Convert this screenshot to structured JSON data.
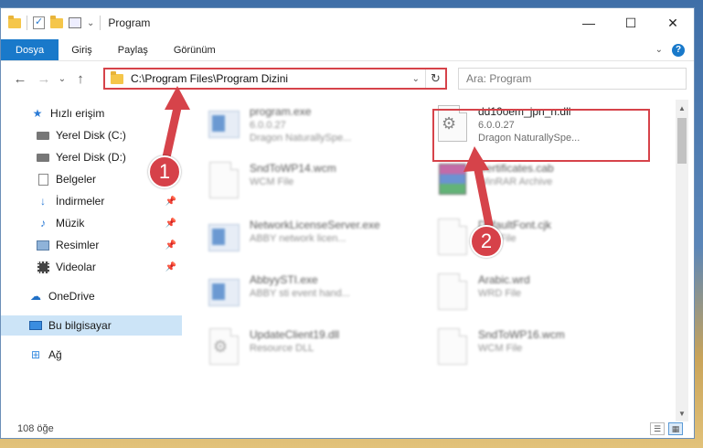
{
  "titlebar": {
    "title": "Program",
    "minimize": "—",
    "maximize": "☐",
    "close": "✕"
  },
  "ribbon": {
    "tabs": [
      {
        "label": "Dosya",
        "active": true
      },
      {
        "label": "Giriş"
      },
      {
        "label": "Paylaş"
      },
      {
        "label": "Görünüm"
      }
    ],
    "expand_glyph": "⌄",
    "help_glyph": "?"
  },
  "navigation": {
    "back": "←",
    "forward": "→",
    "history": "⌄",
    "up": "↑",
    "address_path": "C:\\Program Files\\Program Dizini",
    "address_dropdown": "⌄",
    "refresh": "↻",
    "search_placeholder": "Ara: Program"
  },
  "sidebar": {
    "items": [
      {
        "label": "Hızlı erişim",
        "icon": "star-icon"
      },
      {
        "label": "Yerel Disk (C:)",
        "icon": "drive-icon",
        "pinned": true
      },
      {
        "label": "Yerel Disk (D:)",
        "icon": "drive-icon",
        "pinned": true
      },
      {
        "label": "Belgeler",
        "icon": "documents-icon",
        "pinned": true
      },
      {
        "label": "İndirmeler",
        "icon": "downloads-icon",
        "pinned": true
      },
      {
        "label": "Müzik",
        "icon": "music-icon",
        "pinned": true
      },
      {
        "label": "Resimler",
        "icon": "pictures-icon",
        "pinned": true
      },
      {
        "label": "Videolar",
        "icon": "videos-icon",
        "pinned": true
      },
      {
        "label": "OneDrive",
        "icon": "cloud-icon"
      },
      {
        "label": "Bu bilgisayar",
        "icon": "computer-icon",
        "selected": true
      },
      {
        "label": "Ağ",
        "icon": "network-icon"
      }
    ],
    "pin_glyph": "📌"
  },
  "files": [
    {
      "name": "program.exe",
      "line2": "6.0.0.27",
      "line3": "Dragon NaturallySpe...",
      "icon": "app-icon",
      "blurred": true
    },
    {
      "name": "dd10oem_jpn_n.dll",
      "line2": "6.0.0.27",
      "line3": "Dragon NaturallySpe...",
      "icon": "dll-gear-icon",
      "blurred": false
    },
    {
      "name": "SndToWP14.wcm",
      "line2": "WCM File",
      "icon": "document-icon",
      "blurred": true
    },
    {
      "name": "Certificates.cab",
      "line2": "WinRAR Archive",
      "icon": "rar-icon",
      "blurred": true
    },
    {
      "name": "NetworkLicenseServer.exe",
      "line2": "ABBY network licen...",
      "icon": "app-icon",
      "blurred": true
    },
    {
      "name": "DefaultFont.cjk",
      "line2": "CJK File",
      "icon": "document-icon",
      "blurred": true
    },
    {
      "name": "AbbyySTI.exe",
      "line2": "ABBY sti event hand...",
      "icon": "app-icon",
      "blurred": true
    },
    {
      "name": "Arabic.wrd",
      "line2": "WRD File",
      "icon": "document-icon",
      "blurred": true
    },
    {
      "name": "UpdateClient19.dll",
      "line2": "Resource DLL",
      "icon": "dll-gear-icon",
      "blurred": true
    },
    {
      "name": "SndToWP16.wcm",
      "line2": "WCM File",
      "icon": "document-icon",
      "blurred": true
    }
  ],
  "status": {
    "count": "108 öğe"
  },
  "annotations": {
    "step1": "1",
    "step2": "2",
    "color": "#d6434a"
  }
}
